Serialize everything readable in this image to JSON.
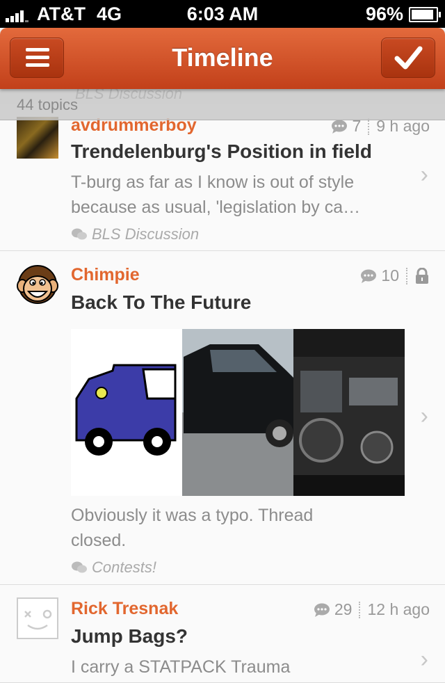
{
  "status_bar": {
    "carrier": "AT&T",
    "network": "4G",
    "time": "6:03 AM",
    "battery": "96%",
    "battery_level": 0.96
  },
  "nav": {
    "title": "Timeline",
    "menu_icon": "hamburger-icon",
    "check_icon": "checkmark-icon"
  },
  "banner": {
    "count": "44 topics",
    "ghost_category": "BLS Discussion"
  },
  "topics": [
    {
      "username": "avdrummerboy",
      "title": "Trendelenburg's Position in field",
      "excerpt": "T-burg as far as I know is out of style because as usual, 'legislation by ca…",
      "category": "BLS Discussion",
      "replies": "7",
      "age": "9 h ago"
    },
    {
      "username": "Chimpie",
      "title": "Back To The Future",
      "excerpt": "Obviously it was a typo. Thread closed.",
      "category": "Contests!",
      "replies": "10",
      "locked": true
    },
    {
      "username": "Rick Tresnak",
      "title": "Jump Bags?",
      "excerpt": "I carry a STATPACK Trauma",
      "replies": "29",
      "age": "12 h ago"
    }
  ],
  "colors": {
    "accent": "#e2672f",
    "nav_top": "#e36a3c",
    "nav_bottom": "#c2401a"
  }
}
